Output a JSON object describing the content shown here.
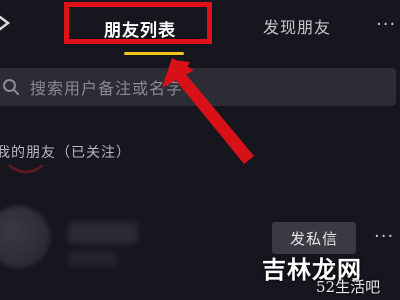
{
  "header": {
    "tabs": [
      {
        "label": "朋友列表",
        "active": true
      },
      {
        "label": "发现朋友",
        "active": false
      }
    ],
    "more_label": "···"
  },
  "search": {
    "placeholder": "搜索用户备注或名字"
  },
  "section": {
    "title": "我的朋友（已关注）"
  },
  "friend_row": {
    "message_label": "发私信",
    "more_label": "···"
  },
  "watermark": {
    "main": "吉林龙网",
    "sub": "52生活吧"
  },
  "colors": {
    "background": "#16161e",
    "highlight": "#e0101a",
    "tab_underline": "#f5c518",
    "search_bg": "#2c2c34",
    "button_bg": "#3a3a42"
  },
  "icons": {
    "back": "back-arrow-icon",
    "search": "search-icon",
    "more": "more-dots-icon"
  }
}
